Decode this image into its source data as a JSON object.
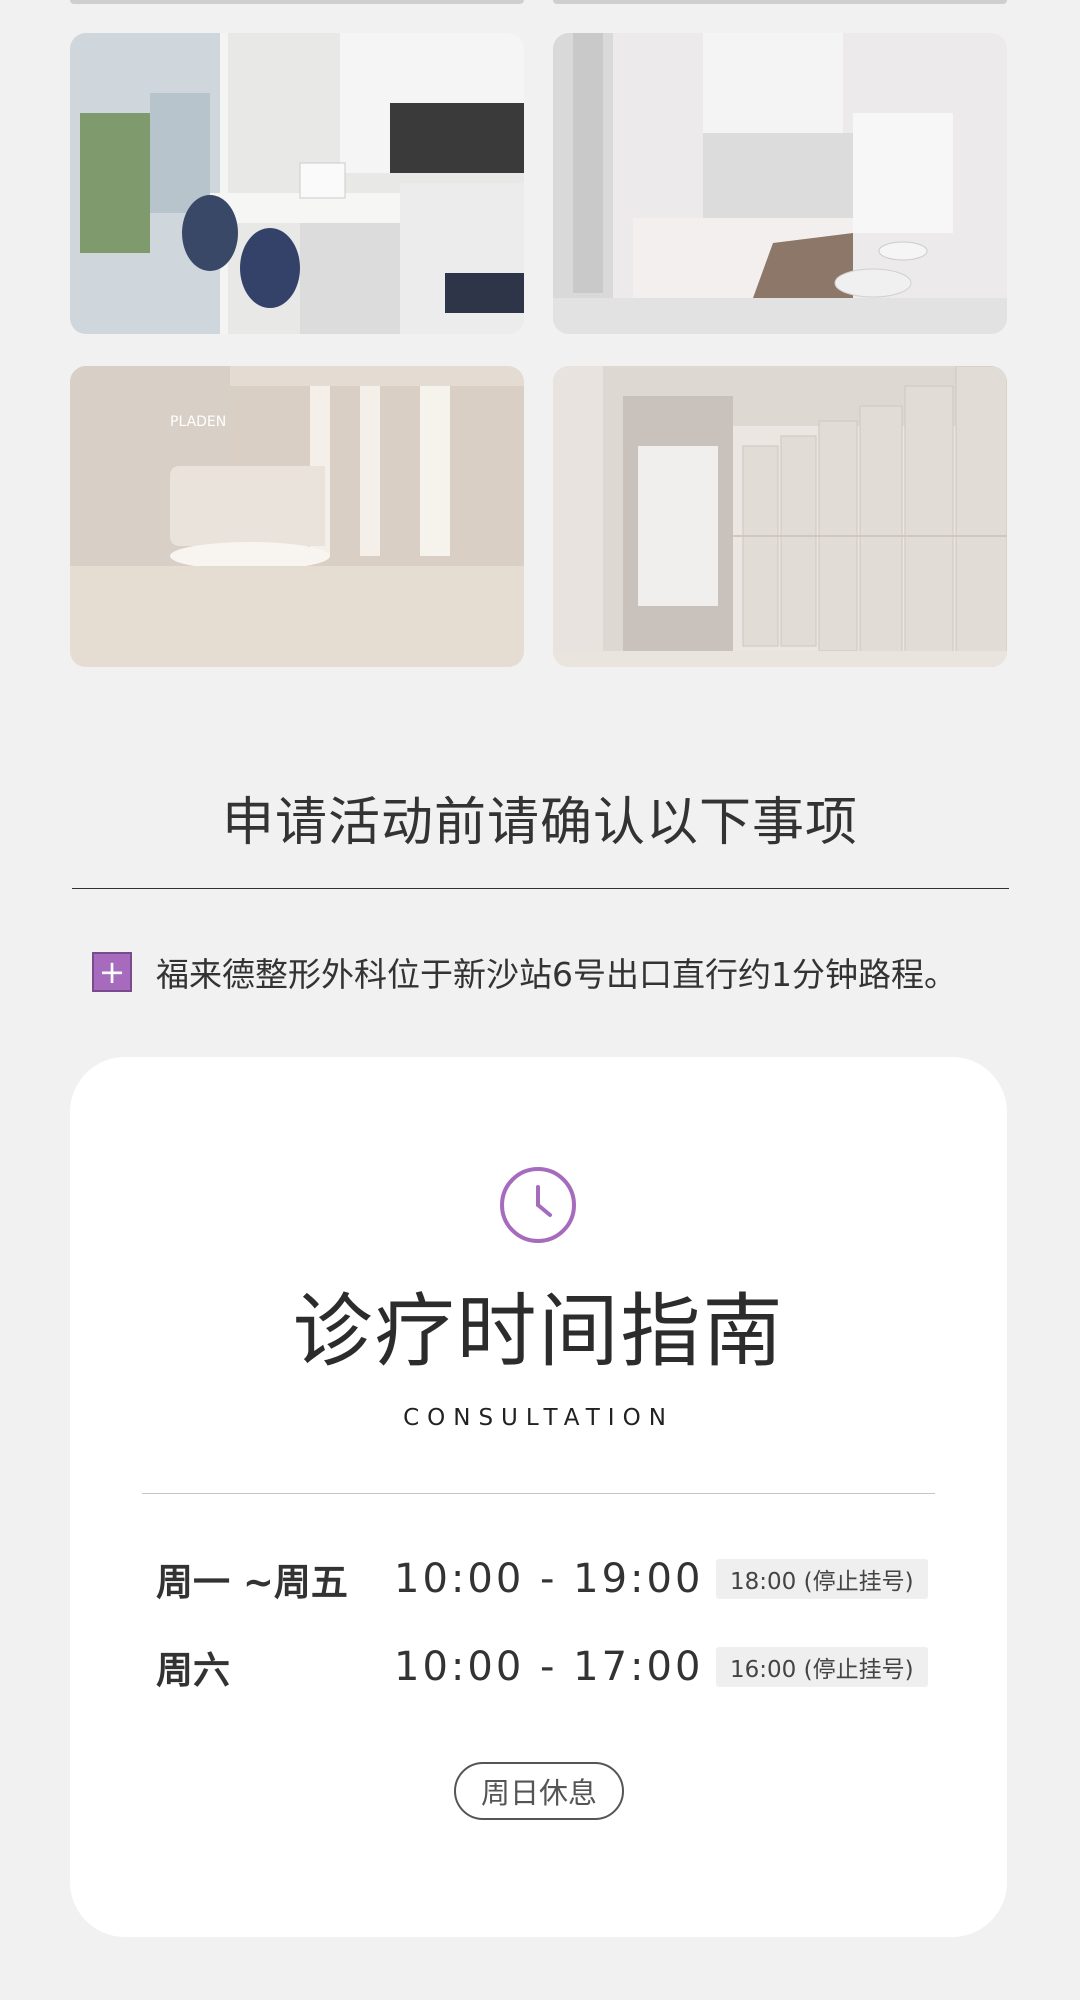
{
  "notice": {
    "title": "申请活动前请确认以下事项",
    "items": [
      {
        "icon": "plus-icon",
        "text": "福来德整形外科位于新沙站6号出口直行约1分钟路程。"
      }
    ]
  },
  "hours_card": {
    "icon": "clock-icon",
    "title": "诊疗时间指南",
    "subtitle": "CONSULTATION",
    "rows": [
      {
        "day": "周一 ~周五",
        "time": "10:00 - 19:00",
        "note": "18:00 (停止挂号)"
      },
      {
        "day": "周六",
        "time": "10:00 - 17:00",
        "note": "16:00 (停止挂号)"
      }
    ],
    "closed_label": "周日休息"
  },
  "colors": {
    "accent": "#a66bbd",
    "background": "#f1f1f1",
    "card": "#ffffff"
  }
}
